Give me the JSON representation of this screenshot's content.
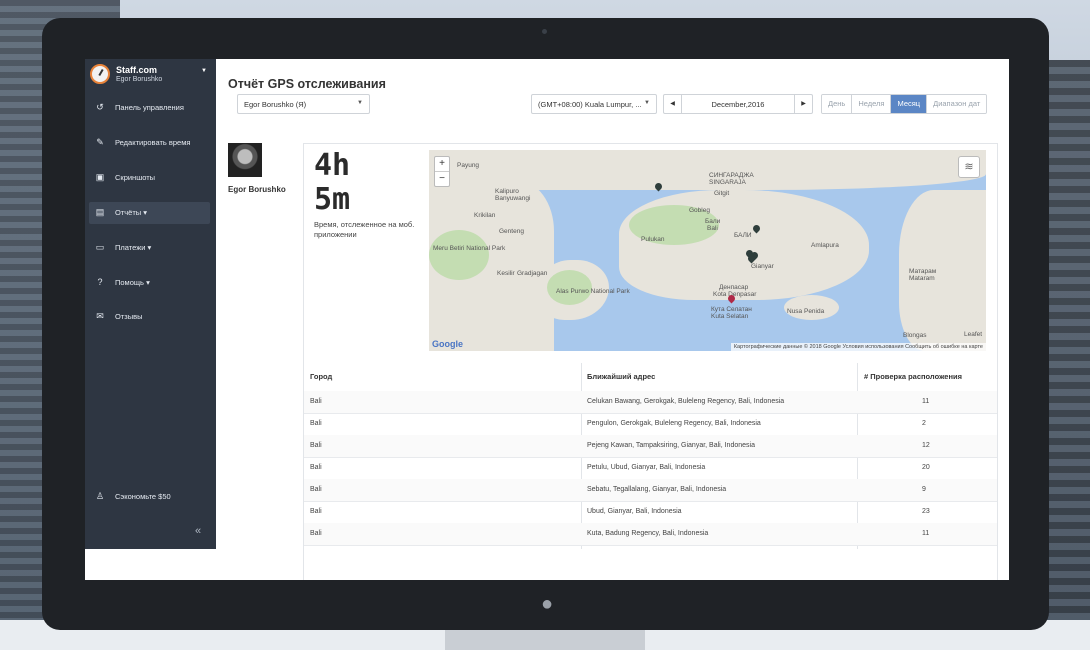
{
  "brand": {
    "name": "Staff.com",
    "user": "Egor Borushko"
  },
  "sidebar": {
    "items": [
      {
        "label": "Панель управления",
        "icon": "dashboard-icon",
        "glyph": "↺"
      },
      {
        "label": "Редактировать время",
        "icon": "edit-time-icon",
        "glyph": "✎"
      },
      {
        "label": "Скриншоты",
        "icon": "screenshots-icon",
        "glyph": "▣"
      },
      {
        "label": "Отчёты",
        "icon": "reports-icon",
        "glyph": "▤",
        "caret": "▾"
      },
      {
        "label": "Платежи",
        "icon": "payments-icon",
        "glyph": "▭",
        "caret": "▾"
      },
      {
        "label": "Помощь",
        "icon": "help-icon",
        "glyph": "?",
        "caret": "▾"
      },
      {
        "label": "Отзывы",
        "icon": "feedback-icon",
        "glyph": "✉"
      }
    ],
    "save_label": "Сэкономьте $50",
    "collapse_glyph": "«"
  },
  "header": {
    "title": "Отчёт GPS отслеживания",
    "user_select": "Egor Borushko (Я)",
    "timezone_select": "(GMT+08:00) Kuala Lumpur, ...",
    "date_value": "December,2016",
    "periods": [
      "День",
      "Неделя",
      "Месяц",
      "Диапазон дат"
    ],
    "active_period": "Месяц"
  },
  "profile": {
    "name": "Egor Borushko"
  },
  "stats": {
    "hours": "4h",
    "minutes": "5m",
    "description": "Время, отслеженное на моб. приложении"
  },
  "map": {
    "zoom_in": "+",
    "zoom_out": "−",
    "attribution": "Картографические данные © 2018 Google   Условия использования   Сообщить об ошибке на карте",
    "google": "Google",
    "labels": {
      "l1": "Payung",
      "l2": "Kalipuro",
      "l3": "Banyuwangi",
      "l4": "Krikilan",
      "l5": "Genteng",
      "l6": "Meru Betiri National Park",
      "l7": "Kesilir",
      "l8": "Gradjagan",
      "l9": "Alas Purwo National Park",
      "l10": "СИНГАРАДЖА",
      "l11": "SINGARAJA",
      "l12": "Gitgit",
      "l13": "Gobleg",
      "l14": "Бали",
      "l15": "Bali",
      "l16": "БАЛИ",
      "l17": "Pulukan",
      "l18": "Gianyar",
      "l19": "Денпасар",
      "l20": "Kota Denpasar",
      "l21": "Кута Селатан",
      "l22": "Kuta Selatan",
      "l23": "Nusa Penida",
      "l24": "Amlapura",
      "l25": "Матарам",
      "l26": "Mataram",
      "l27": "Blongas",
      "l28": "Leafet"
    }
  },
  "table": {
    "headers": [
      "Город",
      "Ближайший адрес",
      "# Проверка расположения"
    ],
    "rows": [
      {
        "city": "Bali",
        "address": "Celukan Bawang, Gerokgak, Buleleng Regency, Bali, Indonesia",
        "count": "11"
      },
      {
        "city": "Bali",
        "address": "Pengulon, Gerokgak, Buleleng Regency, Bali, Indonesia",
        "count": "2"
      },
      {
        "city": "Bali",
        "address": "Pejeng Kawan, Tampaksiring, Gianyar, Bali, Indonesia",
        "count": "12"
      },
      {
        "city": "Bali",
        "address": "Petulu, Ubud, Gianyar, Bali, Indonesia",
        "count": "20"
      },
      {
        "city": "Bali",
        "address": "Sebatu, Tegallalang, Gianyar, Bali, Indonesia",
        "count": "9"
      },
      {
        "city": "Bali",
        "address": "Ubud, Gianyar, Bali, Indonesia",
        "count": "23"
      },
      {
        "city": "Bali",
        "address": "Kuta, Badung Regency, Bali, Indonesia",
        "count": "11"
      }
    ]
  },
  "colors": {
    "sidebar": "#2e3642",
    "accent": "#5b86c5",
    "logo": "#e8833a"
  }
}
